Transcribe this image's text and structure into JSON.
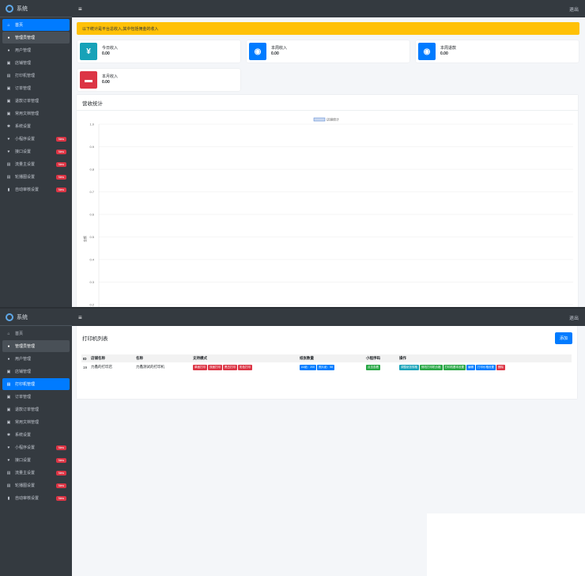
{
  "brand": "系统",
  "nav": [
    {
      "label": "首页",
      "icon": "home-icon",
      "glyph": "⌂",
      "badge": ""
    },
    {
      "label": "管理员管理",
      "icon": "user-icon",
      "glyph": "●",
      "badge": ""
    },
    {
      "label": "用户管理",
      "icon": "user-icon",
      "glyph": "●",
      "badge": ""
    },
    {
      "label": "店铺管理",
      "icon": "shop-icon",
      "glyph": "▣",
      "badge": ""
    },
    {
      "label": "打印机管理",
      "icon": "printer-icon",
      "glyph": "▤",
      "badge": ""
    },
    {
      "label": "订单管理",
      "icon": "order-icon",
      "glyph": "▣",
      "badge": ""
    },
    {
      "label": "退款订单管理",
      "icon": "refund-icon",
      "glyph": "▣",
      "badge": ""
    },
    {
      "label": "常用文档管理",
      "icon": "doc-icon",
      "glyph": "▣",
      "badge": ""
    },
    {
      "label": "系统设置",
      "icon": "gear-icon",
      "glyph": "✱",
      "badge": ""
    },
    {
      "label": "小程序设置",
      "icon": "heart-icon",
      "glyph": "♥",
      "badge": "New"
    },
    {
      "label": "接口设置",
      "icon": "heart-icon",
      "glyph": "♥",
      "badge": "New"
    },
    {
      "label": "流量主设置",
      "icon": "ad-icon",
      "glyph": "▤",
      "badge": "New"
    },
    {
      "label": "轮播图设置",
      "icon": "image-icon",
      "glyph": "▤",
      "badge": "New"
    },
    {
      "label": "自动审核设置",
      "icon": "file-icon",
      "glyph": "▮",
      "badge": "New"
    }
  ],
  "topbar": {
    "menu": "≡",
    "logout": "退出"
  },
  "dashboard": {
    "alert": "以下统计是平台总收入,其中包括佣金的收入",
    "boxes": [
      {
        "label": "今日收入",
        "value": "0.00",
        "color": "#17a2b8",
        "glyph": "¥"
      },
      {
        "label": "本周收入",
        "value": "0.00",
        "color": "#007bff",
        "glyph": "◉"
      },
      {
        "label": "本周退款",
        "value": "0.00",
        "color": "#007bff",
        "glyph": "◉"
      },
      {
        "label": "本月收入",
        "value": "0.00",
        "color": "#dc3545",
        "glyph": "▬"
      }
    ],
    "chart_title": "营收统计"
  },
  "chart_data": {
    "type": "line",
    "title": "",
    "legend": [
      "店铺统计"
    ],
    "legend_position": "top",
    "ylabel": "金额",
    "xlabel": "",
    "y_ticks": [
      "1.0",
      "0.9",
      "0.8",
      "0.7",
      "0.6",
      "0.5",
      "0.4",
      "0.3",
      "0.2"
    ],
    "ylim": [
      0.2,
      1.0
    ],
    "series": [
      {
        "name": "店铺统计",
        "values": []
      }
    ],
    "grid": true
  },
  "printer_page": {
    "title": "打印机列表",
    "add_label": "添加",
    "columns": [
      "ID",
      "店铺名称",
      "名称",
      "支持模式",
      "纸张数量",
      "小程序码",
      "操作"
    ],
    "rows": [
      {
        "id": "19",
        "shop": "力鑫的打印店",
        "name": "力鑫测试的打印机",
        "modes": [
          "单面打印",
          "双面打印",
          "黑白打印",
          "彩色打印"
        ],
        "paper": [
          "A4纸：200",
          "照片纸：58"
        ],
        "qrcode": "点击查看",
        "actions": [
          {
            "label": "调整纸张规格",
            "color": "teal"
          },
          {
            "label": "修改打印机价格",
            "color": "green"
          },
          {
            "label": "打印机基本设置",
            "color": "green"
          },
          {
            "label": "编辑",
            "color": "blue"
          },
          {
            "label": "打印价格设置",
            "color": "blue"
          },
          {
            "label": "删除",
            "color": "red"
          }
        ]
      }
    ]
  }
}
